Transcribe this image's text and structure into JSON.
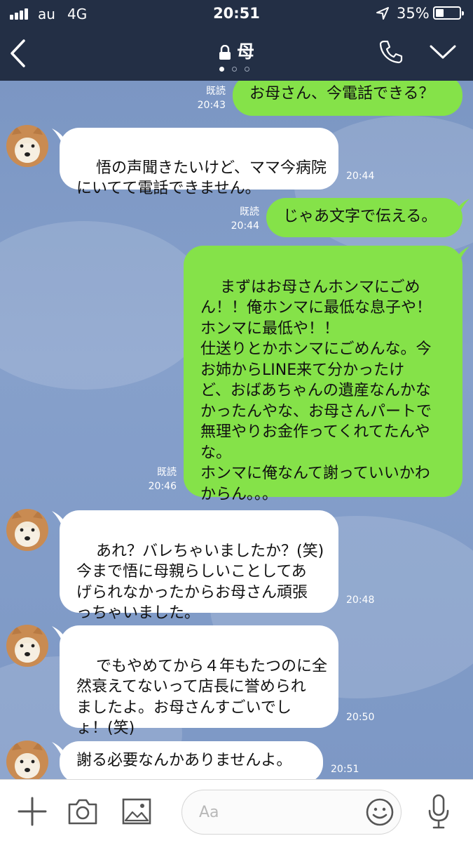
{
  "status_bar": {
    "carrier": "au",
    "network": "4G",
    "time": "20:51",
    "battery_percent": "35%",
    "battery_level": 0.35,
    "signal_icon": "signal-bars-icon",
    "location_icon": "location-arrow-icon"
  },
  "header": {
    "title": "母",
    "lock_icon": "lock-icon",
    "back_icon": "chevron-left-icon",
    "call_icon": "phone-icon",
    "menu_icon": "chevron-down-icon",
    "page_indicator": {
      "count": 3,
      "active": 0
    }
  },
  "messages": [
    {
      "direction": "out",
      "text": "お母さん、今電話できる？",
      "read": "既読",
      "time": "20:43"
    },
    {
      "direction": "in",
      "text": "悟の声聞きたいけど、ママ今病院\nにいてて電話できません。",
      "time": "20:44"
    },
    {
      "direction": "out",
      "text": "じゃあ文字で伝える。",
      "read": "既読",
      "time": "20:44"
    },
    {
      "direction": "out",
      "text": "まずはお母さんホンマにごめ\nん！！俺ホンマに最低な息子や！\nホンマに最低や！！\n仕送りとかホンマにごめんな。今\nお姉からLINE来て分かったけ\nど、おばあちゃんの遺産なんかな\nかったんやな、お母さんパートで\n無理やりお金作ってくれてたんや\nな。\nホンマに俺なんて謝っていいかわ\nからん。。。",
      "read": "既読",
      "time": "20:46"
    },
    {
      "direction": "in",
      "text": "あれ？バレちゃいましたか？(笑)\n今まで悟に母親らしいことしてあ\nげられなかったからお母さん頑張\nっちゃいました。",
      "time": "20:48"
    },
    {
      "direction": "in",
      "text": "でもやめてから４年もたつのに全\n然衰えてないって店長に誉められ\nましたよ。お母さんすごいでし\nょ！(笑)",
      "time": "20:50"
    },
    {
      "direction": "in",
      "text": "謝る必要なんかありませんよ。",
      "time": "20:51"
    }
  ],
  "input_bar": {
    "placeholder": "Aa",
    "add_icon": "plus-icon",
    "camera_icon": "camera-icon",
    "image_icon": "image-icon",
    "emoji_icon": "emoji-icon",
    "mic_icon": "microphone-icon"
  },
  "colors": {
    "header_bg": "#232f45",
    "chat_bg": "#7c97c4",
    "outgoing_bubble": "#85e249",
    "incoming_bubble": "#ffffff",
    "icon_gray": "#555555"
  }
}
